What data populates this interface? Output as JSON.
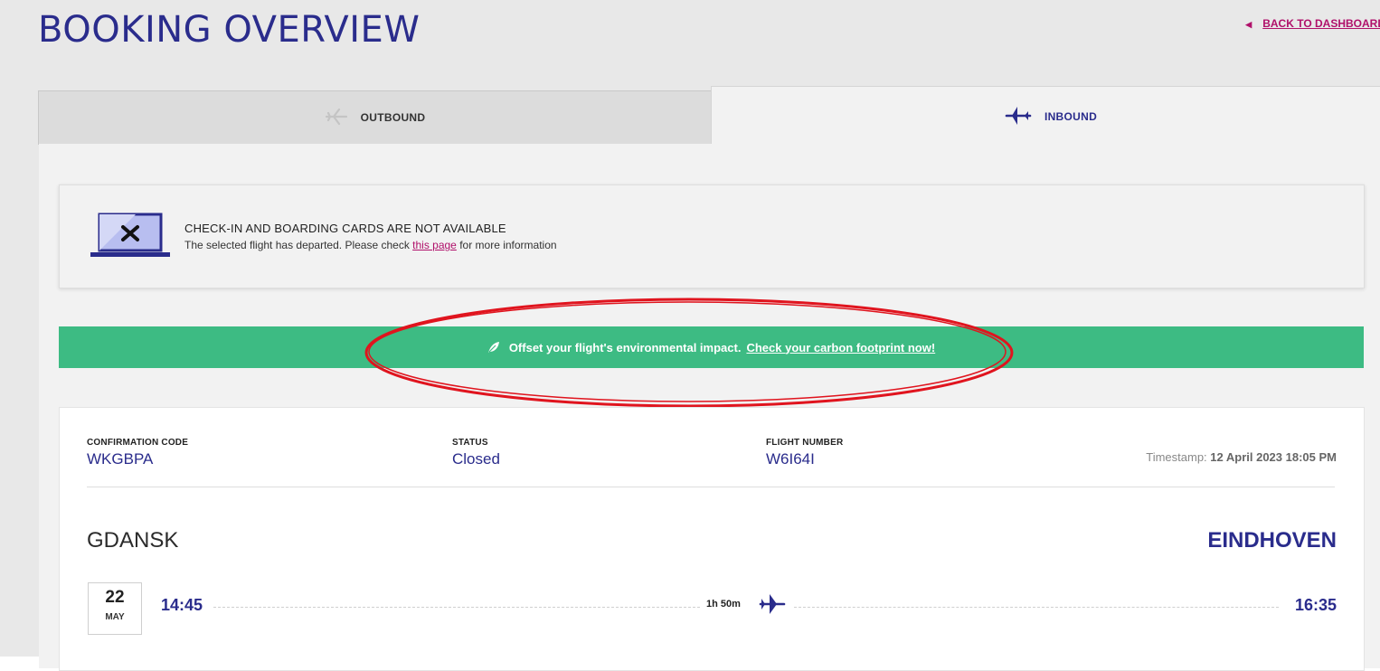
{
  "page": {
    "title": "BOOKING OVERVIEW",
    "back_link": "BACK TO DASHBOARD"
  },
  "tabs": [
    {
      "label": "OUTBOUND",
      "icon": "plane-takeoff-icon",
      "active": false
    },
    {
      "label": "INBOUND",
      "icon": "plane-landing-icon",
      "active": true
    }
  ],
  "alert": {
    "title": "CHECK-IN AND BOARDING CARDS ARE NOT AVAILABLE",
    "message_before": "The selected flight has departed. Please check ",
    "link_text": "this page",
    "message_after": " for more information",
    "icon": "laptop-x-icon"
  },
  "eco_banner": {
    "text": "Offset your flight's environmental impact.",
    "link_text": "Check your carbon footprint now!",
    "icon": "leaf-icon",
    "color": "#3dbb83"
  },
  "booking": {
    "confirmation_label": "CONFIRMATION CODE",
    "confirmation_code": "WKGBPA",
    "status_label": "STATUS",
    "status_value": "Closed",
    "flight_label": "FLIGHT NUMBER",
    "flight_number": "W6I64I",
    "timestamp_prefix": "Timestamp: ",
    "timestamp_value": "12 April 2023 18:05 PM"
  },
  "route": {
    "from_city": "GDANSK",
    "to_city": "EINDHOVEN",
    "date_day": "22",
    "date_month": "MAY",
    "departure_time": "14:45",
    "arrival_time": "16:35",
    "duration": "1h 50m"
  },
  "colors": {
    "brand_navy": "#2a2c8c",
    "brand_magenta": "#b0106a",
    "annotation_red": "#e0141e"
  }
}
